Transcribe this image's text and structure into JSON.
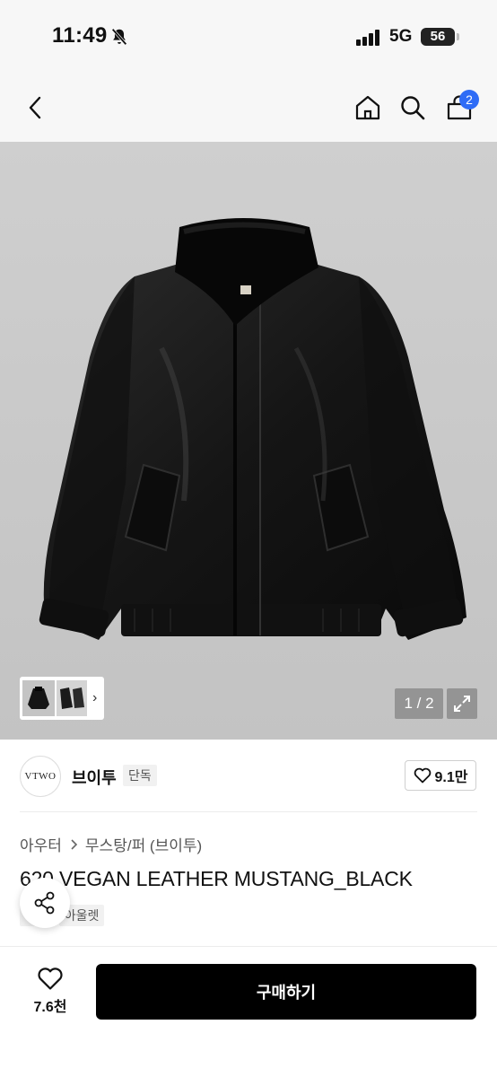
{
  "status_bar": {
    "time": "11:49",
    "network": "5G",
    "battery": "56",
    "icons": [
      "bell-muted-icon",
      "signal-icon",
      "battery-icon"
    ]
  },
  "nav": {
    "icons": [
      "back-icon",
      "home-icon",
      "search-icon",
      "cart-icon"
    ],
    "cart_badge": "2"
  },
  "gallery": {
    "page_indicator": "1 / 2",
    "next_thumb_glyph": "›",
    "icons": [
      "expand-icon",
      "chevron-right-icon"
    ]
  },
  "brand": {
    "logo_text": "VTWO",
    "name": "브이투",
    "tag": "단독",
    "like_count": "9.1만"
  },
  "product": {
    "breadcrumb": [
      "아우터",
      "무스탕/퍼 (브이투)"
    ],
    "title": "620 VEGAN LEATHER MUSTANG_BLACK",
    "tags": [
      "단독",
      "아울렛"
    ]
  },
  "bottom": {
    "like_count": "7.6천",
    "buy_label": "구매하기"
  },
  "colors": {
    "background": "#ffffff",
    "header_bg": "#f7f7f7",
    "image_bg": "#c9c9c9",
    "accent_badge": "#2f6cf6",
    "buy_button": "#000000"
  }
}
